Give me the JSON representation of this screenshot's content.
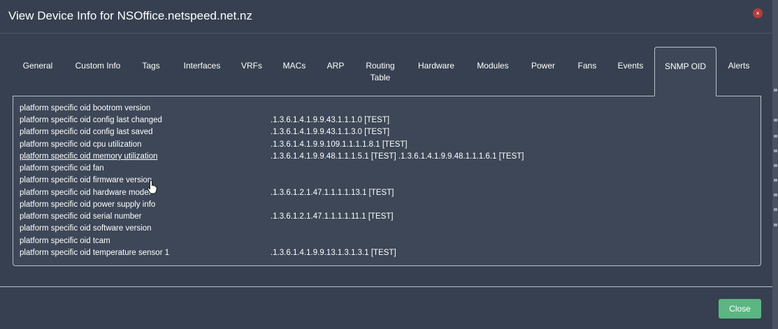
{
  "header": {
    "title": "View Device Info for NSOffice.netspeed.net.nz",
    "close_glyph": "×"
  },
  "tabs": [
    {
      "label": "General",
      "active": false
    },
    {
      "label": "Custom Info",
      "active": false
    },
    {
      "label": "Tags",
      "active": false
    },
    {
      "label": "Interfaces",
      "active": false
    },
    {
      "label": "VRFs",
      "active": false
    },
    {
      "label": "MACs",
      "active": false
    },
    {
      "label": "ARP",
      "active": false
    },
    {
      "label": "Routing\nTable",
      "active": false
    },
    {
      "label": "Hardware",
      "active": false
    },
    {
      "label": "Modules",
      "active": false
    },
    {
      "label": "Power",
      "active": false
    },
    {
      "label": "Fans",
      "active": false
    },
    {
      "label": "Events",
      "active": false
    },
    {
      "label": "SNMP OID",
      "active": true
    },
    {
      "label": "Alerts",
      "active": false
    }
  ],
  "snmp_oids": [
    {
      "name": "platform specific oid bootrom version",
      "value": ""
    },
    {
      "name": "platform specific oid config last changed",
      "value": ".1.3.6.1.4.1.9.9.43.1.1.1.0  [TEST]"
    },
    {
      "name": "platform specific oid config last saved",
      "value": ".1.3.6.1.4.1.9.9.43.1.1.3.0  [TEST]"
    },
    {
      "name": "platform specific oid cpu utilization",
      "value": ".1.3.6.1.4.1.9.9.109.1.1.1.1.8.1  [TEST]"
    },
    {
      "name": "platform specific oid memory utilization",
      "value": ".1.3.6.1.4.1.9.9.48.1.1.1.5.1  [TEST]   .1.3.6.1.4.1.9.9.48.1.1.1.6.1  [TEST]",
      "hovered": true
    },
    {
      "name": "platform specific oid fan",
      "value": ""
    },
    {
      "name": "platform specific oid firmware version",
      "value": ""
    },
    {
      "name": "platform specific oid hardware model",
      "value": ".1.3.6.1.2.1.47.1.1.1.1.13.1  [TEST]"
    },
    {
      "name": "platform specific oid power supply info",
      "value": ""
    },
    {
      "name": "platform specific oid serial number",
      "value": ".1.3.6.1.2.1.47.1.1.1.1.11.1  [TEST]"
    },
    {
      "name": "platform specific oid software version",
      "value": ""
    },
    {
      "name": "platform specific oid tcam",
      "value": ""
    },
    {
      "name": "platform specific oid temperature sensor 1",
      "value": ".1.3.6.1.4.1.9.9.13.1.3.1.3.1  [TEST]"
    }
  ],
  "footer": {
    "close_label": "Close"
  },
  "colors": {
    "background": "#364050",
    "panel": "#3d4757",
    "close_button": "#5cb683",
    "close_x": "#b83b3b"
  }
}
